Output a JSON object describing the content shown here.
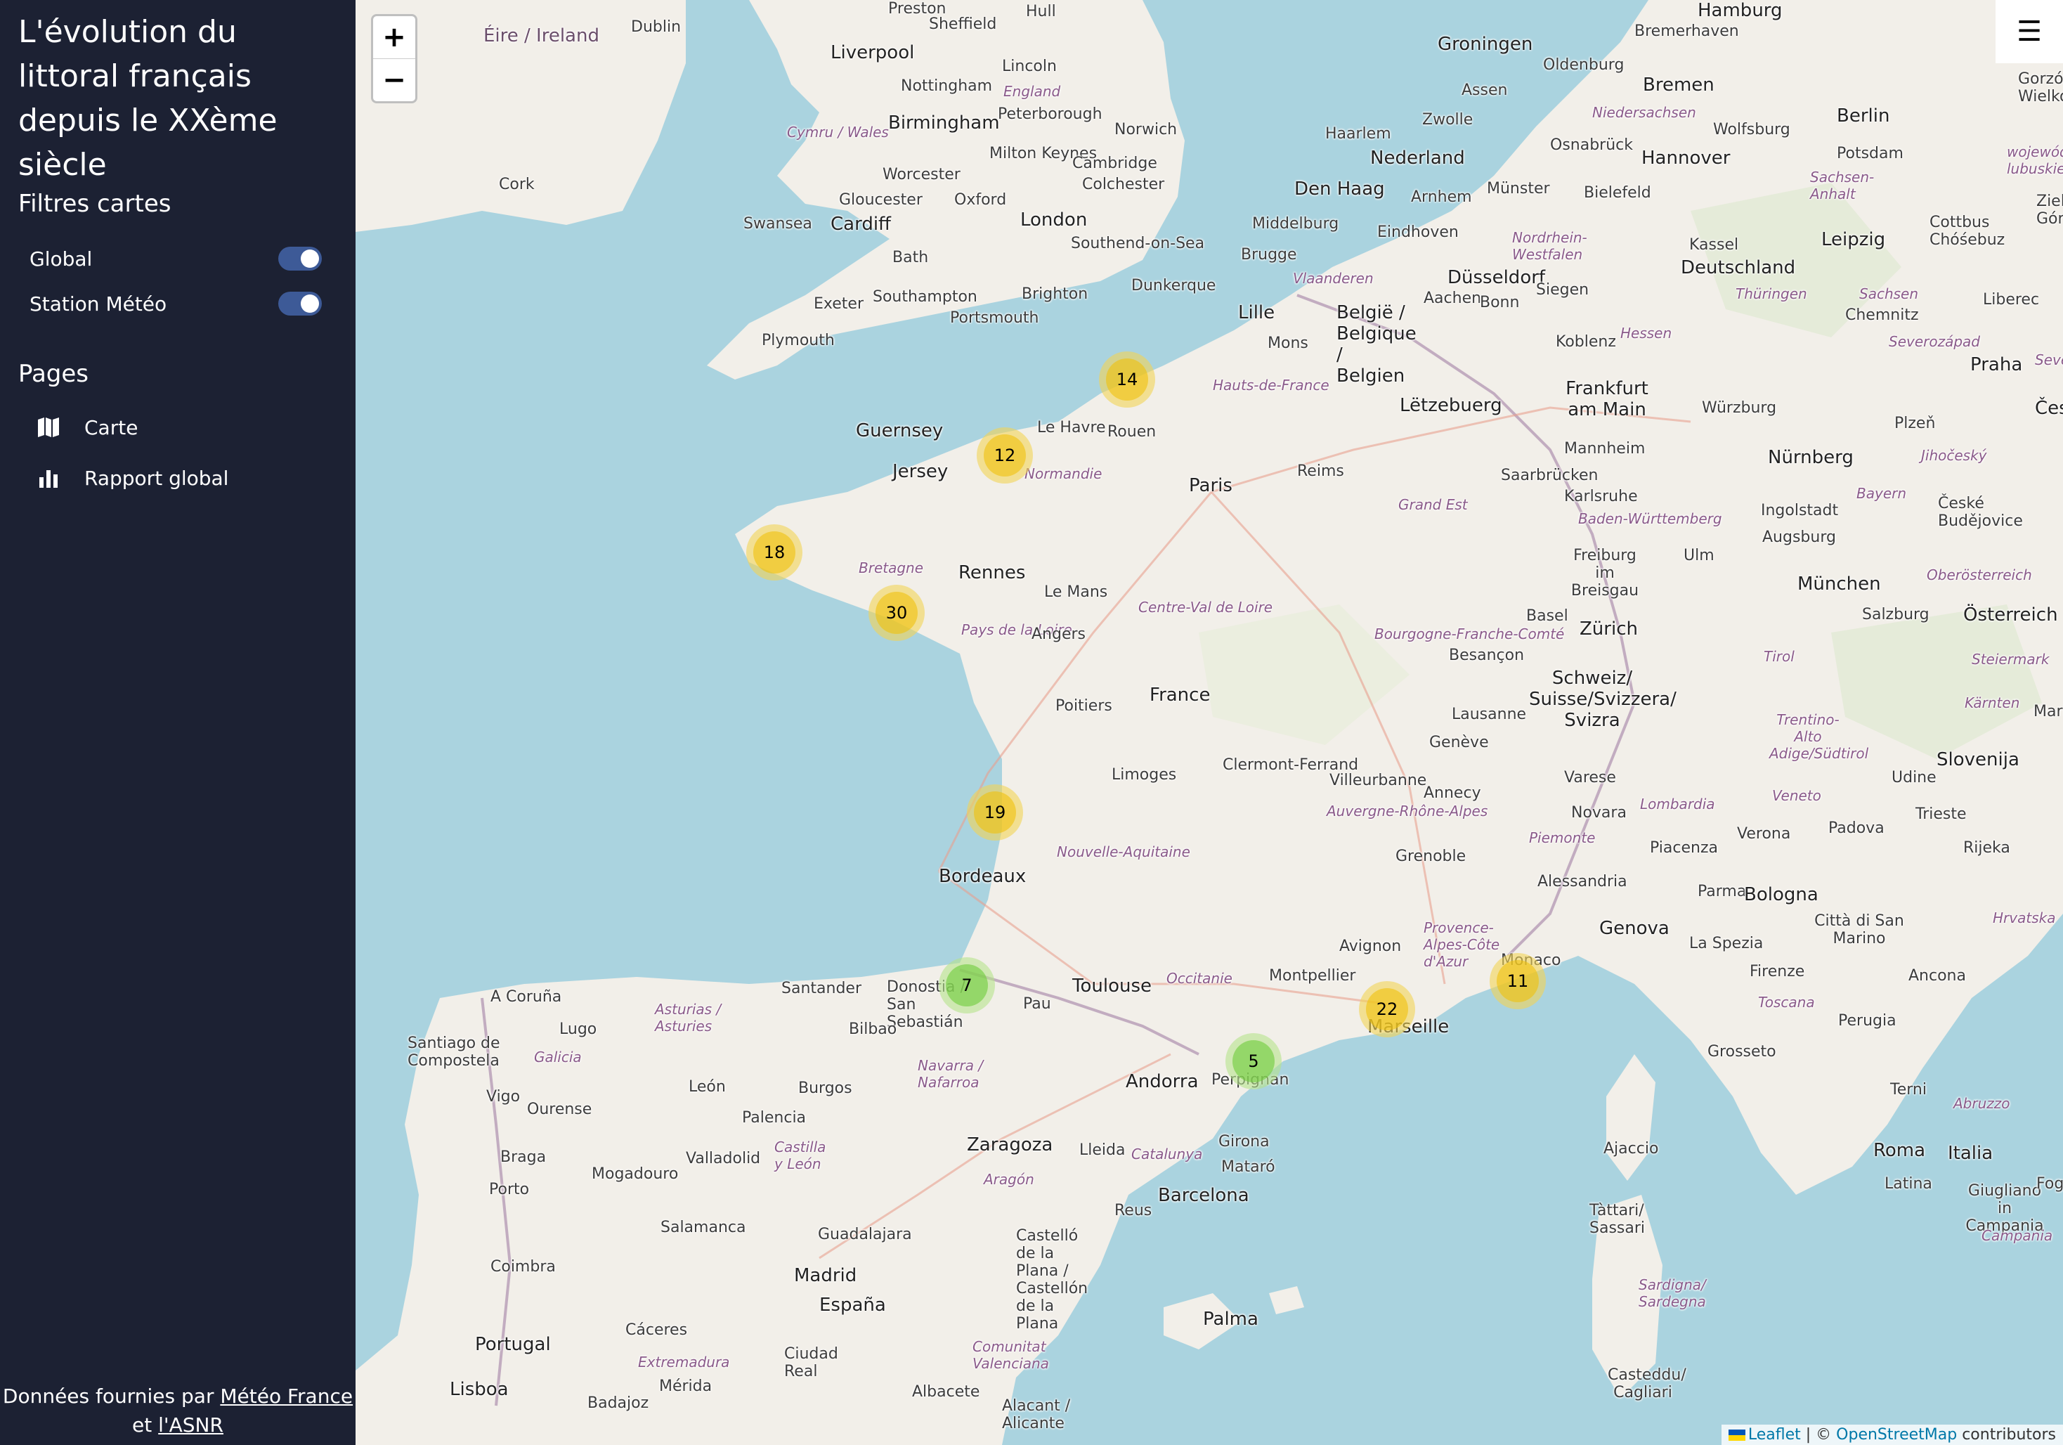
{
  "sidebar": {
    "title": "L'évolution du littoral français depuis le XXème siècle",
    "filters_title": "Filtres cartes",
    "filters": [
      {
        "label": "Global",
        "enabled": true
      },
      {
        "label": "Station Météo",
        "enabled": true
      }
    ],
    "pages_title": "Pages",
    "pages": [
      {
        "label": "Carte",
        "icon": "map-icon"
      },
      {
        "label": "Rapport global",
        "icon": "bar-chart-icon"
      }
    ],
    "footer": {
      "prefix": "Données fournies par",
      "link1": "Météo France",
      "middle": "et",
      "link2": "l'ASNR"
    }
  },
  "map": {
    "zoom_in": "+",
    "zoom_out": "−",
    "menu_icon": "☰",
    "clusters": [
      {
        "count": "14",
        "color": "yellow"
      },
      {
        "count": "12",
        "color": "yellow"
      },
      {
        "count": "18",
        "color": "yellow"
      },
      {
        "count": "30",
        "color": "yellow"
      },
      {
        "count": "19",
        "color": "yellow"
      },
      {
        "count": "7",
        "color": "green"
      },
      {
        "count": "5",
        "color": "green"
      },
      {
        "count": "22",
        "color": "yellow"
      },
      {
        "count": "11",
        "color": "yellow"
      }
    ],
    "labels": {
      "eire": "Éire / Ireland",
      "dublin": "Dublin",
      "cork": "Cork",
      "liverpool": "Liverpool",
      "sheffield": "Sheffield",
      "preston": "Preston",
      "hull": "Hull",
      "lincoln": "Lincoln",
      "nottingham": "Nottingham",
      "england": "England",
      "birmingham": "Birmingham",
      "peterborough": "Peterborough",
      "norwich": "Norwich",
      "cymru": "Cymru / Wales",
      "milton": "Milton Keynes",
      "cambridge": "Cambridge",
      "worcester": "Worcester",
      "colchester": "Colchester",
      "gloucester": "Gloucester",
      "oxford": "Oxford",
      "london": "London",
      "swansea": "Swansea",
      "cardiff": "Cardiff",
      "southend": "Southend-on-Sea",
      "bath": "Bath",
      "southampton": "Southampton",
      "brighton": "Brighton",
      "exeter": "Exeter",
      "portsmouth": "Portsmouth",
      "plymouth": "Plymouth",
      "dunkerque": "Dunkerque",
      "guernsey": "Guernsey",
      "jersey": "Jersey",
      "lehavre": "Le Havre",
      "rouen": "Rouen",
      "normandie": "Normandie",
      "hautsdefrance": "Hauts-de-France",
      "lille": "Lille",
      "mons": "Mons",
      "paris": "Paris",
      "reims": "Reims",
      "bretagne": "Bretagne",
      "rennes": "Rennes",
      "lemans": "Le Mans",
      "paysdelaloire": "Pays de la Loire",
      "angers": "Angers",
      "centrevaldeloire": "Centre-Val de Loire",
      "france": "France",
      "poitiers": "Poitiers",
      "limoges": "Limoges",
      "clermont": "Clermont-Ferrand",
      "bordeaux": "Bordeaux",
      "nouvelleaquitaine": "Nouvelle-Aquitaine",
      "villeurbanne": "Villeurbanne",
      "auvergne": "Auvergne-Rhône-Alpes",
      "grenoble": "Grenoble",
      "bourgogne": "Bourgogne-Franche-Comté",
      "besancon": "Besançon",
      "grandest": "Grand Est",
      "toulouse": "Toulouse",
      "occitanie": "Occitanie",
      "montpellier": "Montpellier",
      "avignon": "Avignon",
      "marseille": "Marseille",
      "provence": "Provence-Alpes-Côte d'Azur",
      "monaco": "Monaco",
      "pau": "Pau",
      "andorra": "Andorra",
      "perpignan": "Perpignan",
      "santander": "Santander",
      "donostia": "Donostia / San Sebastián",
      "bilbao": "Bilbao",
      "acoruna": "A Coruña",
      "lugo": "Lugo",
      "asturias": "Asturias / Asturies",
      "santiago": "Santiago de Compostela",
      "galicia": "Galicia",
      "navarra": "Navarra / Nafarroa",
      "leon": "León",
      "burgos": "Burgos",
      "vigo": "Vigo",
      "ourense": "Ourense",
      "palencia": "Palencia",
      "castilla": "Castilla y León",
      "zaragoza": "Zaragoza",
      "lleida": "Lleida",
      "catalunya": "Catalunya",
      "girona": "Girona",
      "mataro": "Mataró",
      "barcelona": "Barcelona",
      "aragon": "Aragón",
      "reus": "Reus",
      "braga": "Braga",
      "valladolid": "Valladolid",
      "porto": "Porto",
      "mogadouro": "Mogadouro",
      "salamanca": "Salamanca",
      "guadalajara": "Guadalajara",
      "madrid": "Madrid",
      "espana": "España",
      "castello": "Castelló de la Plana / Castellón de la Plana",
      "coimbra": "Coimbra",
      "portugal": "Portugal",
      "caceres": "Cáceres",
      "extremadura": "Extremadura",
      "ciudadreal": "Ciudad Real",
      "comunitat": "Comunitat Valenciana",
      "palma": "Palma",
      "lisboa": "Lisboa",
      "merida": "Mérida",
      "badajoz": "Badajoz",
      "albacete": "Albacete",
      "alicante": "Alacant / Alicante",
      "groningen": "Groningen",
      "oldenburg": "Oldenburg",
      "bremerhaven": "Bremerhaven",
      "hamburg": "Hamburg",
      "bremen": "Bremen",
      "assen": "Assen",
      "zwolle": "Zwolle",
      "niedersachsen": "Niedersachsen",
      "osnabruck": "Osnabrück",
      "wolfsburg": "Wolfsburg",
      "berlin": "Berlin",
      "potsdam": "Potsdam",
      "haarlem": "Haarlem",
      "nederland": "Nederland",
      "hannover": "Hannover",
      "denhaag": "Den Haag",
      "arnhem": "Arnhem",
      "munster": "Münster",
      "bielefeld": "Bielefeld",
      "sachsenanhalt": "Sachsen-Anhalt",
      "middelburg": "Middelburg",
      "eindhoven": "Eindhoven",
      "kassel": "Kassel",
      "cottbus": "Cottbus Chóśebuz",
      "leipzig": "Leipzig",
      "nordrhein": "Nordrhein-Westfalen",
      "brugge": "Brugge",
      "dusseldorf": "Düsseldorf",
      "vlaanderen": "Vlaanderen",
      "siegen": "Siegen",
      "deutschland": "Deutschland",
      "aachen": "Aachen",
      "bonn": "Bonn",
      "thuringen": "Thüringen",
      "sachsen": "Sachsen",
      "belgie": "België / Belgique / Belgien",
      "chemnitz": "Chemnitz",
      "hessen": "Hessen",
      "koblenz": "Koblenz",
      "liberec": "Liberec",
      "praha": "Praha",
      "frankfurt": "Frankfurt am Main",
      "letzebuerg": "Lëtzebuerg",
      "wurzburg": "Würzburg",
      "plzen": "Plzeň",
      "mannheim": "Mannheim",
      "saarbrucken": "Saarbrücken",
      "nurnberg": "Nürnberg",
      "jihocesky": "Jihočeský",
      "karlsruhe": "Karlsruhe",
      "ingolstadt": "Ingolstadt",
      "bayern": "Bayern",
      "ceske": "České Budějovice",
      "badenw": "Baden-Württemberg",
      "augsburg": "Augsburg",
      "freiburg": "Freiburg im Breisgau",
      "ulm": "Ulm",
      "munchen": "München",
      "oberosterreich": "Oberösterreich",
      "basel": "Basel",
      "zurich": "Zürich",
      "salzburg": "Salzburg",
      "osterreich": "Österreich",
      "tirol": "Tirol",
      "steiermark": "Steiermark",
      "schweiz": "Schweiz/ Suisse/Svizzera/ Svizra",
      "lausanne": "Lausanne",
      "geneve": "Genève",
      "kaernten": "Kärnten",
      "trentino": "Trentino-Alto Adige/Südtirol",
      "slovenija": "Slovenija",
      "udine": "Udine",
      "annecy": "Annecy",
      "varese": "Varese",
      "veneto": "Veneto",
      "lombardia": "Lombardia",
      "trieste": "Trieste",
      "novara": "Novara",
      "padova": "Padova",
      "piemonte": "Piemonte",
      "verona": "Verona",
      "piacenza": "Piacenza",
      "rijeka": "Rijeka",
      "alessandria": "Alessandria",
      "parma": "Parma",
      "bologna": "Bologna",
      "hrvatska": "Hrvatska",
      "genova": "Genova",
      "laspezia": "La Spezia",
      "sanmarino": "Città di San Marino",
      "firenze": "Firenze",
      "ancona": "Ancona",
      "toscana": "Toscana",
      "perugia": "Perugia",
      "grosseto": "Grosseto",
      "terni": "Terni",
      "abruzzo": "Abruzzo",
      "ajaccio": "Ajaccio",
      "roma": "Roma",
      "italia": "Italia",
      "latina": "Latina",
      "giugliano": "Giugliano in Campania",
      "campania": "Campania",
      "tattari": "Tàttari/ Sassari",
      "sardigna": "Sardigna/ Sardegna",
      "casteddu": "Casteddu/ Cagliari",
      "gorzow": "Gorzów Wielkopolski",
      "wojewodztwo": "województwo lubuskie",
      "zielona": "Zielona Góra",
      "ceska": "Česk",
      "sever": "Sever",
      "severozapad": "Severozápad",
      "mari": "Mari",
      "fogg": "Fogg"
    },
    "attribution": {
      "leaflet": "Leaflet",
      "sep": " | © ",
      "osm": "OpenStreetMap",
      "suffix": " contributors"
    }
  }
}
